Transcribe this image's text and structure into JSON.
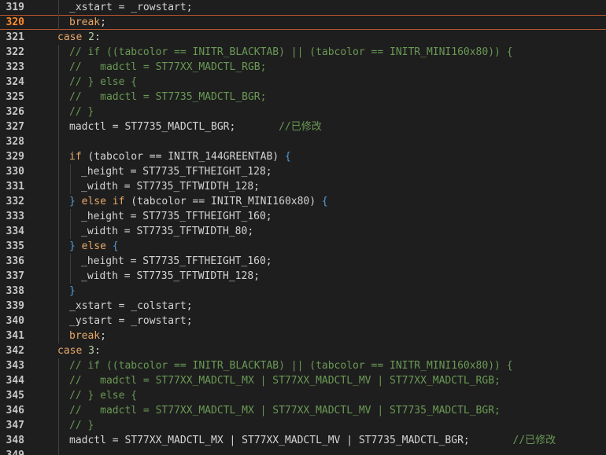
{
  "editor": {
    "current_line": 320,
    "lines": [
      {
        "n": "319",
        "indent": 2,
        "tokens": [
          [
            "pl",
            "_xstart = _rowstart;"
          ]
        ]
      },
      {
        "n": "320",
        "indent": 2,
        "tokens": [
          [
            "kw",
            "break"
          ],
          [
            "pl",
            ";"
          ]
        ]
      },
      {
        "n": "321",
        "indent": 1,
        "tokens": [
          [
            "kw",
            "case"
          ],
          [
            "pl",
            " "
          ],
          [
            "num",
            "2"
          ],
          [
            "pl",
            ":"
          ]
        ]
      },
      {
        "n": "322",
        "indent": 2,
        "tokens": [
          [
            "cm",
            "// if ((tabcolor == INITR_BLACKTAB) || (tabcolor == INITR_MINI160x80)) {"
          ]
        ]
      },
      {
        "n": "323",
        "indent": 2,
        "tokens": [
          [
            "cm",
            "//   madctl = ST77XX_MADCTL_RGB;"
          ]
        ]
      },
      {
        "n": "324",
        "indent": 2,
        "tokens": [
          [
            "cm",
            "// } else {"
          ]
        ]
      },
      {
        "n": "325",
        "indent": 2,
        "tokens": [
          [
            "cm",
            "//   madctl = ST7735_MADCTL_BGR;"
          ]
        ]
      },
      {
        "n": "326",
        "indent": 2,
        "tokens": [
          [
            "cm",
            "// }"
          ]
        ]
      },
      {
        "n": "327",
        "indent": 2,
        "tokens": [
          [
            "pl",
            "madctl = ST7735_MADCTL_BGR;       "
          ],
          [
            "cm",
            "//已修改"
          ]
        ]
      },
      {
        "n": "328",
        "indent": 2,
        "tokens": []
      },
      {
        "n": "329",
        "indent": 2,
        "tokens": [
          [
            "kw",
            "if"
          ],
          [
            "pl",
            " (tabcolor == INITR_144GREENTAB) "
          ],
          [
            "brk",
            "{"
          ]
        ]
      },
      {
        "n": "330",
        "indent": 3,
        "tokens": [
          [
            "pl",
            "_height = ST7735_TFTHEIGHT_128;"
          ]
        ]
      },
      {
        "n": "331",
        "indent": 3,
        "tokens": [
          [
            "pl",
            "_width = ST7735_TFTWIDTH_128;"
          ]
        ]
      },
      {
        "n": "332",
        "indent": 2,
        "tokens": [
          [
            "brk",
            "}"
          ],
          [
            "pl",
            " "
          ],
          [
            "kw",
            "else if"
          ],
          [
            "pl",
            " (tabcolor == INITR_MINI160x80) "
          ],
          [
            "brk",
            "{"
          ]
        ]
      },
      {
        "n": "333",
        "indent": 3,
        "tokens": [
          [
            "pl",
            "_height = ST7735_TFTHEIGHT_160;"
          ]
        ]
      },
      {
        "n": "334",
        "indent": 3,
        "tokens": [
          [
            "pl",
            "_width = ST7735_TFTWIDTH_80;"
          ]
        ]
      },
      {
        "n": "335",
        "indent": 2,
        "tokens": [
          [
            "brk",
            "}"
          ],
          [
            "pl",
            " "
          ],
          [
            "kw",
            "else"
          ],
          [
            "pl",
            " "
          ],
          [
            "brk",
            "{"
          ]
        ]
      },
      {
        "n": "336",
        "indent": 3,
        "tokens": [
          [
            "pl",
            "_height = ST7735_TFTHEIGHT_160;"
          ]
        ]
      },
      {
        "n": "337",
        "indent": 3,
        "tokens": [
          [
            "pl",
            "_width = ST7735_TFTWIDTH_128;"
          ]
        ]
      },
      {
        "n": "338",
        "indent": 2,
        "tokens": [
          [
            "brk",
            "}"
          ]
        ]
      },
      {
        "n": "339",
        "indent": 2,
        "tokens": [
          [
            "pl",
            "_xstart = _colstart;"
          ]
        ]
      },
      {
        "n": "340",
        "indent": 2,
        "tokens": [
          [
            "pl",
            "_ystart = _rowstart;"
          ]
        ]
      },
      {
        "n": "341",
        "indent": 2,
        "tokens": [
          [
            "kw",
            "break"
          ],
          [
            "pl",
            ";"
          ]
        ]
      },
      {
        "n": "342",
        "indent": 1,
        "tokens": [
          [
            "kw",
            "case"
          ],
          [
            "pl",
            " "
          ],
          [
            "num",
            "3"
          ],
          [
            "pl",
            ":"
          ]
        ]
      },
      {
        "n": "343",
        "indent": 2,
        "tokens": [
          [
            "cm",
            "// if ((tabcolor == INITR_BLACKTAB) || (tabcolor == INITR_MINI160x80)) {"
          ]
        ]
      },
      {
        "n": "344",
        "indent": 2,
        "tokens": [
          [
            "cm",
            "//   madctl = ST77XX_MADCTL_MX | ST77XX_MADCTL_MV | ST77XX_MADCTL_RGB;"
          ]
        ]
      },
      {
        "n": "345",
        "indent": 2,
        "tokens": [
          [
            "cm",
            "// } else {"
          ]
        ]
      },
      {
        "n": "346",
        "indent": 2,
        "tokens": [
          [
            "cm",
            "//   madctl = ST77XX_MADCTL_MX | ST77XX_MADCTL_MV | ST7735_MADCTL_BGR;"
          ]
        ]
      },
      {
        "n": "347",
        "indent": 2,
        "tokens": [
          [
            "cm",
            "// }"
          ]
        ]
      },
      {
        "n": "348",
        "indent": 2,
        "tokens": [
          [
            "pl",
            "madctl = ST77XX_MADCTL_MX | ST77XX_MADCTL_MV | ST7735_MADCTL_BGR;       "
          ],
          [
            "cm",
            "//已修改"
          ]
        ]
      },
      {
        "n": "349",
        "indent": 2,
        "tokens": []
      }
    ]
  }
}
